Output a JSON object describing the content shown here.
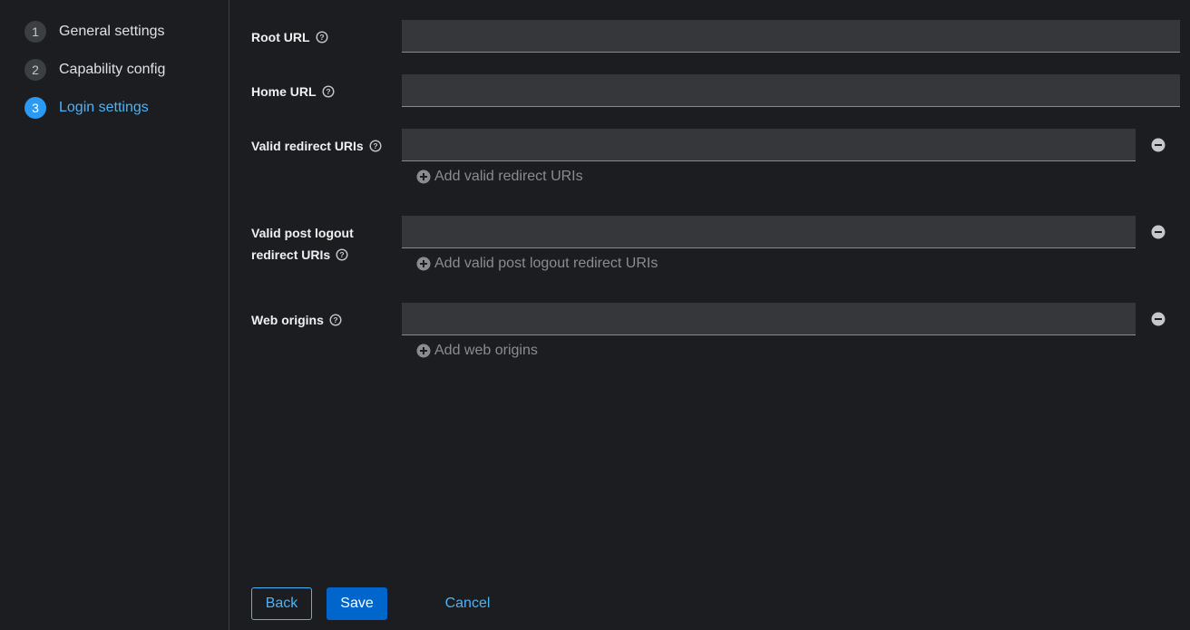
{
  "wizard": {
    "steps": [
      {
        "number": "1",
        "label": "General settings"
      },
      {
        "number": "2",
        "label": "Capability config"
      },
      {
        "number": "3",
        "label": "Login settings"
      }
    ],
    "current_step": 3
  },
  "form": {
    "root_url": {
      "label": "Root URL",
      "value": ""
    },
    "home_url": {
      "label": "Home URL",
      "value": ""
    },
    "valid_redirect_uris": {
      "label": "Valid redirect URIs",
      "value": "",
      "add_label": "Add valid redirect URIs"
    },
    "valid_post_logout": {
      "label_line1": "Valid post logout",
      "label_line2": "redirect URIs",
      "value": "",
      "add_label": "Add valid post logout redirect URIs"
    },
    "web_origins": {
      "label": "Web origins",
      "value": "",
      "add_label": "Add web origins"
    }
  },
  "footer": {
    "back_label": "Back",
    "save_label": "Save",
    "cancel_label": "Cancel"
  },
  "icons": {
    "help": "help-icon",
    "remove": "minus-circle-icon",
    "add": "plus-circle-icon"
  },
  "colors": {
    "accent": "#2b9af3",
    "primary_button": "#0066cc",
    "link": "#4db3f7"
  }
}
